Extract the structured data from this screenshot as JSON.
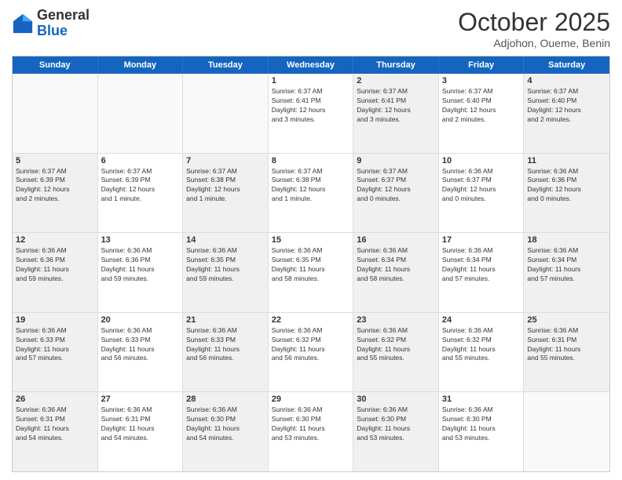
{
  "header": {
    "logo": {
      "line1": "General",
      "line2": "Blue"
    },
    "title": "October 2025",
    "subtitle": "Adjohon, Oueme, Benin"
  },
  "weekdays": [
    "Sunday",
    "Monday",
    "Tuesday",
    "Wednesday",
    "Thursday",
    "Friday",
    "Saturday"
  ],
  "rows": [
    [
      {
        "day": "",
        "lines": [],
        "empty": true
      },
      {
        "day": "",
        "lines": [],
        "empty": true
      },
      {
        "day": "",
        "lines": [],
        "empty": true
      },
      {
        "day": "1",
        "lines": [
          "Sunrise: 6:37 AM",
          "Sunset: 6:41 PM",
          "Daylight: 12 hours",
          "and 3 minutes."
        ]
      },
      {
        "day": "2",
        "lines": [
          "Sunrise: 6:37 AM",
          "Sunset: 6:41 PM",
          "Daylight: 12 hours",
          "and 3 minutes."
        ],
        "shaded": true
      },
      {
        "day": "3",
        "lines": [
          "Sunrise: 6:37 AM",
          "Sunset: 6:40 PM",
          "Daylight: 12 hours",
          "and 2 minutes."
        ]
      },
      {
        "day": "4",
        "lines": [
          "Sunrise: 6:37 AM",
          "Sunset: 6:40 PM",
          "Daylight: 12 hours",
          "and 2 minutes."
        ],
        "shaded": true
      }
    ],
    [
      {
        "day": "5",
        "lines": [
          "Sunrise: 6:37 AM",
          "Sunset: 6:39 PM",
          "Daylight: 12 hours",
          "and 2 minutes."
        ],
        "shaded": true
      },
      {
        "day": "6",
        "lines": [
          "Sunrise: 6:37 AM",
          "Sunset: 6:39 PM",
          "Daylight: 12 hours",
          "and 1 minute."
        ]
      },
      {
        "day": "7",
        "lines": [
          "Sunrise: 6:37 AM",
          "Sunset: 6:38 PM",
          "Daylight: 12 hours",
          "and 1 minute."
        ],
        "shaded": true
      },
      {
        "day": "8",
        "lines": [
          "Sunrise: 6:37 AM",
          "Sunset: 6:38 PM",
          "Daylight: 12 hours",
          "and 1 minute."
        ]
      },
      {
        "day": "9",
        "lines": [
          "Sunrise: 6:37 AM",
          "Sunset: 6:37 PM",
          "Daylight: 12 hours",
          "and 0 minutes."
        ],
        "shaded": true
      },
      {
        "day": "10",
        "lines": [
          "Sunrise: 6:36 AM",
          "Sunset: 6:37 PM",
          "Daylight: 12 hours",
          "and 0 minutes."
        ]
      },
      {
        "day": "11",
        "lines": [
          "Sunrise: 6:36 AM",
          "Sunset: 6:36 PM",
          "Daylight: 12 hours",
          "and 0 minutes."
        ],
        "shaded": true
      }
    ],
    [
      {
        "day": "12",
        "lines": [
          "Sunrise: 6:36 AM",
          "Sunset: 6:36 PM",
          "Daylight: 11 hours",
          "and 59 minutes."
        ],
        "shaded": true
      },
      {
        "day": "13",
        "lines": [
          "Sunrise: 6:36 AM",
          "Sunset: 6:36 PM",
          "Daylight: 11 hours",
          "and 59 minutes."
        ]
      },
      {
        "day": "14",
        "lines": [
          "Sunrise: 6:36 AM",
          "Sunset: 6:35 PM",
          "Daylight: 11 hours",
          "and 59 minutes."
        ],
        "shaded": true
      },
      {
        "day": "15",
        "lines": [
          "Sunrise: 6:36 AM",
          "Sunset: 6:35 PM",
          "Daylight: 11 hours",
          "and 58 minutes."
        ]
      },
      {
        "day": "16",
        "lines": [
          "Sunrise: 6:36 AM",
          "Sunset: 6:34 PM",
          "Daylight: 11 hours",
          "and 58 minutes."
        ],
        "shaded": true
      },
      {
        "day": "17",
        "lines": [
          "Sunrise: 6:36 AM",
          "Sunset: 6:34 PM",
          "Daylight: 11 hours",
          "and 57 minutes."
        ]
      },
      {
        "day": "18",
        "lines": [
          "Sunrise: 6:36 AM",
          "Sunset: 6:34 PM",
          "Daylight: 11 hours",
          "and 57 minutes."
        ],
        "shaded": true
      }
    ],
    [
      {
        "day": "19",
        "lines": [
          "Sunrise: 6:36 AM",
          "Sunset: 6:33 PM",
          "Daylight: 11 hours",
          "and 57 minutes."
        ],
        "shaded": true
      },
      {
        "day": "20",
        "lines": [
          "Sunrise: 6:36 AM",
          "Sunset: 6:33 PM",
          "Daylight: 11 hours",
          "and 56 minutes."
        ]
      },
      {
        "day": "21",
        "lines": [
          "Sunrise: 6:36 AM",
          "Sunset: 6:33 PM",
          "Daylight: 11 hours",
          "and 56 minutes."
        ],
        "shaded": true
      },
      {
        "day": "22",
        "lines": [
          "Sunrise: 6:36 AM",
          "Sunset: 6:32 PM",
          "Daylight: 11 hours",
          "and 56 minutes."
        ]
      },
      {
        "day": "23",
        "lines": [
          "Sunrise: 6:36 AM",
          "Sunset: 6:32 PM",
          "Daylight: 11 hours",
          "and 55 minutes."
        ],
        "shaded": true
      },
      {
        "day": "24",
        "lines": [
          "Sunrise: 6:36 AM",
          "Sunset: 6:32 PM",
          "Daylight: 11 hours",
          "and 55 minutes."
        ]
      },
      {
        "day": "25",
        "lines": [
          "Sunrise: 6:36 AM",
          "Sunset: 6:31 PM",
          "Daylight: 11 hours",
          "and 55 minutes."
        ],
        "shaded": true
      }
    ],
    [
      {
        "day": "26",
        "lines": [
          "Sunrise: 6:36 AM",
          "Sunset: 6:31 PM",
          "Daylight: 11 hours",
          "and 54 minutes."
        ],
        "shaded": true
      },
      {
        "day": "27",
        "lines": [
          "Sunrise: 6:36 AM",
          "Sunset: 6:31 PM",
          "Daylight: 11 hours",
          "and 54 minutes."
        ]
      },
      {
        "day": "28",
        "lines": [
          "Sunrise: 6:36 AM",
          "Sunset: 6:30 PM",
          "Daylight: 11 hours",
          "and 54 minutes."
        ],
        "shaded": true
      },
      {
        "day": "29",
        "lines": [
          "Sunrise: 6:36 AM",
          "Sunset: 6:30 PM",
          "Daylight: 11 hours",
          "and 53 minutes."
        ]
      },
      {
        "day": "30",
        "lines": [
          "Sunrise: 6:36 AM",
          "Sunset: 6:30 PM",
          "Daylight: 11 hours",
          "and 53 minutes."
        ],
        "shaded": true
      },
      {
        "day": "31",
        "lines": [
          "Sunrise: 6:36 AM",
          "Sunset: 6:30 PM",
          "Daylight: 11 hours",
          "and 53 minutes."
        ]
      },
      {
        "day": "",
        "lines": [],
        "empty": true
      }
    ]
  ]
}
